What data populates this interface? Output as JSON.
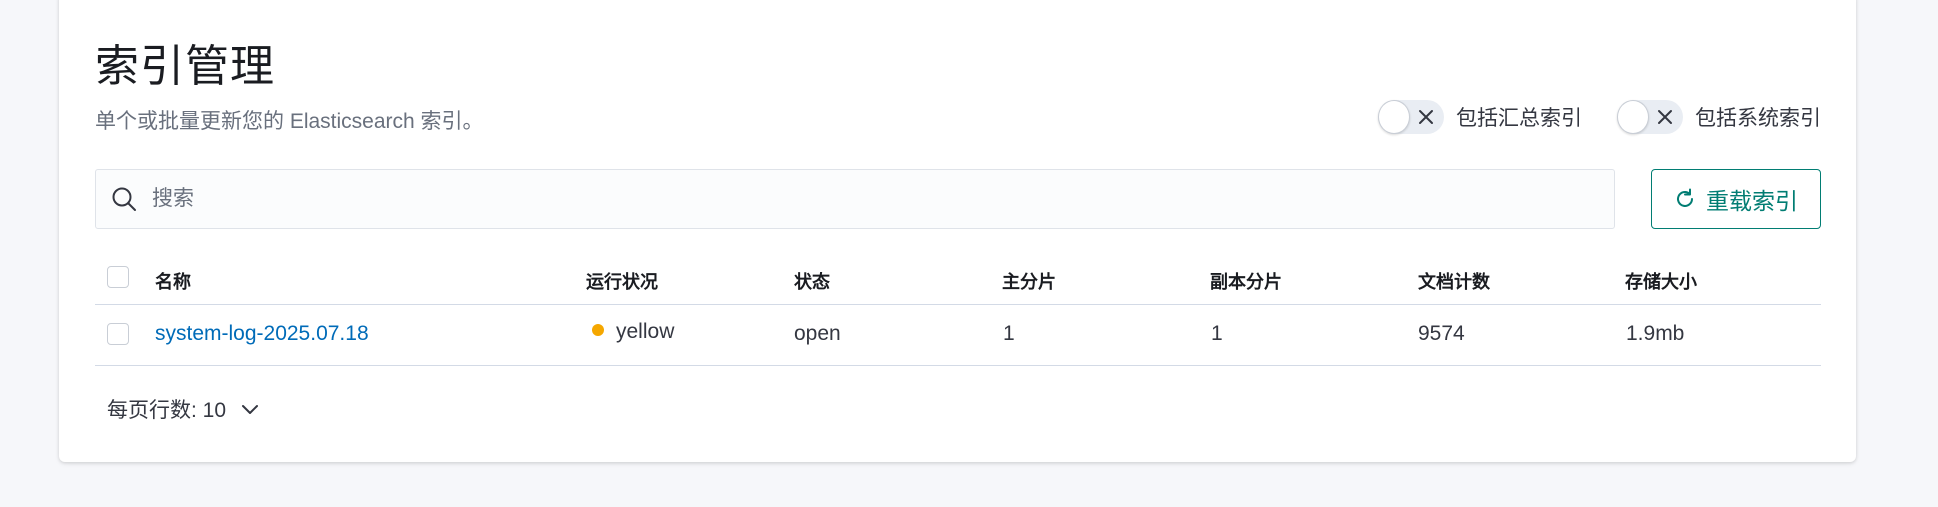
{
  "header": {
    "title": "索引管理",
    "description": "单个或批量更新您的 Elasticsearch 索引。"
  },
  "toggles": [
    {
      "label": "包括汇总索引",
      "checked": false
    },
    {
      "label": "包括系统索引",
      "checked": false
    }
  ],
  "search": {
    "placeholder": "搜索",
    "value": ""
  },
  "reload_button": {
    "label": "重载索引"
  },
  "table": {
    "columns": [
      "名称",
      "运行状况",
      "状态",
      "主分片",
      "副本分片",
      "文档计数",
      "存储大小"
    ],
    "rows": [
      {
        "name": "system-log-2025.07.18",
        "health": "yellow",
        "status": "open",
        "primary": "1",
        "replica": "1",
        "docs": "9574",
        "size": "1.9mb"
      }
    ]
  },
  "pagination": {
    "rows_per_page_label": "每页行数: 10"
  },
  "colors": {
    "accent": "#017d73",
    "link": "#006bb8",
    "health_yellow": "#f5a700"
  },
  "icons": {
    "search": "search-icon",
    "reload": "refresh-icon",
    "toggle_off": "cross-icon",
    "pager": "chevron-down-icon"
  }
}
